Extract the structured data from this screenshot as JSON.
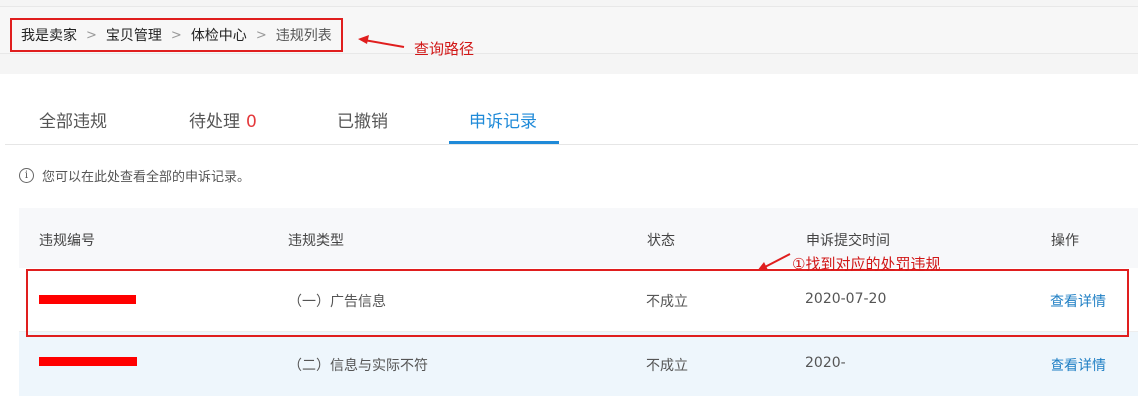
{
  "breadcrumb": {
    "items": [
      "我是卖家",
      "宝贝管理",
      "体检中心",
      "违规列表"
    ],
    "separator": ">"
  },
  "annotations": {
    "query_path": "查询路径",
    "find_penalty": "①找到对应的处罚违规",
    "color": "#d11717"
  },
  "tabs": [
    {
      "label": "全部违规",
      "count": ""
    },
    {
      "label": "待处理",
      "count": "0"
    },
    {
      "label": "已撤销",
      "count": ""
    },
    {
      "label": "申诉记录",
      "count": ""
    }
  ],
  "active_tab": "申诉记录",
  "notice": {
    "text": "您可以在此处查看全部的申诉记录。",
    "icon": "info-icon"
  },
  "table": {
    "columns": [
      "违规编号",
      "违规类型",
      "状态",
      "申诉提交时间",
      "操作"
    ],
    "rows": [
      {
        "id": "",
        "type": "（一）广告信息",
        "status": "不成立",
        "date": "2020-07-20",
        "action": "查看详情"
      },
      {
        "id": "",
        "type": "（二）信息与实际不符",
        "status": "不成立",
        "date": "2020-",
        "action": "查看详情"
      }
    ]
  },
  "colors": {
    "accent": "#1f8ad8",
    "count_badge": "#e4393c",
    "annotation_red": "#e01e1e",
    "redaction": "#ff0000",
    "link": "#1f7fc4"
  }
}
